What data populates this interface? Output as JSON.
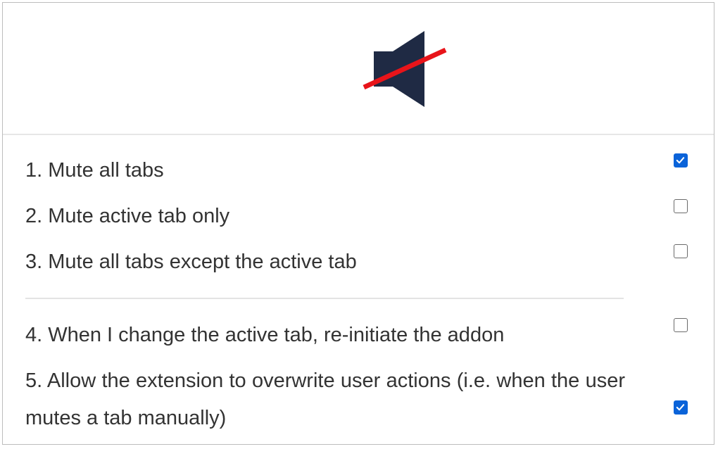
{
  "header": {
    "icon": "speaker-muted-icon",
    "colors": {
      "speaker": "#1f2a44",
      "slash": "#e8141a"
    }
  },
  "options": [
    {
      "label": "1. Mute all tabs",
      "checked": true
    },
    {
      "label": "2. Mute active tab only",
      "checked": false
    },
    {
      "label": "3. Mute all tabs except the active tab",
      "checked": false
    },
    {
      "label": "4. When I change the active tab, re-initiate the addon",
      "checked": false
    },
    {
      "label": "5. Allow the extension to overwrite user actions (i.e. when the user mutes a tab manually)",
      "checked": true
    }
  ],
  "colors": {
    "checkbox_checked": "#0a63d9",
    "text": "#333333"
  }
}
